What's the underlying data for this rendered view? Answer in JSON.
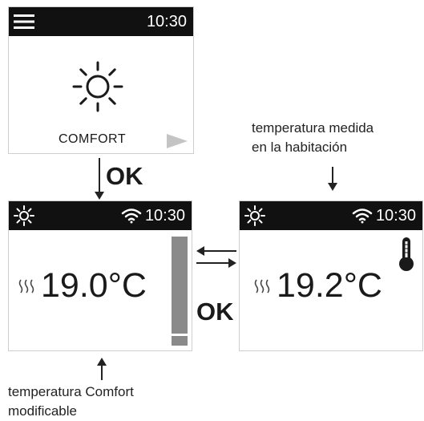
{
  "screen_main": {
    "time": "10:30",
    "mode_label": "COMFORT",
    "icons": {
      "menu": "hamburger-menu-icon",
      "mode": "sun-icon",
      "next": "play-triangle-icon"
    }
  },
  "screen_comfort": {
    "time": "10:30",
    "temperature": "19.0°C",
    "setpoint_level": 0.1,
    "icons": {
      "mode": "sun-icon",
      "wifi": "wifi-icon",
      "heat": "heat-waves-icon"
    }
  },
  "screen_measured": {
    "time": "10:30",
    "temperature": "19.2°C",
    "icons": {
      "mode": "sun-icon",
      "wifi": "wifi-icon",
      "heat": "heat-waves-icon",
      "sensor": "thermometer-icon"
    }
  },
  "labels": {
    "ok_down": "OK",
    "ok_right": "OK",
    "caption_measured": [
      "temperatura medida",
      "en la habitación"
    ],
    "caption_comfort": [
      "temperatura Comfort",
      "modificable"
    ]
  },
  "colors": {
    "bar_bg": "#111111",
    "slider_track": "#8a8a8a",
    "arrow": "#222222"
  }
}
